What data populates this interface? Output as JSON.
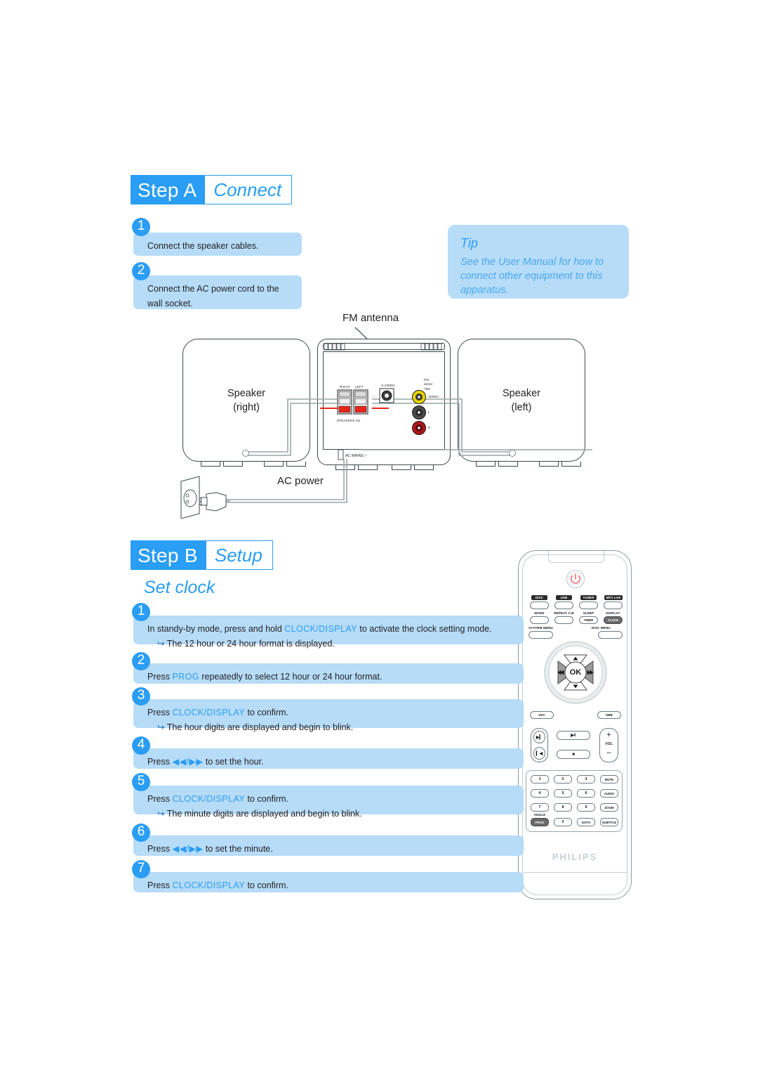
{
  "steps": [
    {
      "id": "step-a",
      "badge": "Step A",
      "title": "Connect",
      "items": [
        {
          "num": "1",
          "text": "Connect the speaker cables."
        },
        {
          "num": "2",
          "text": "Connect the AC power cord to the wall socket."
        }
      ]
    },
    {
      "id": "step-b",
      "badge": "Step B",
      "title": "Setup",
      "subtitle": "Set clock",
      "items": [
        {
          "num": "1",
          "pre": "In standy-by mode, press and hold ",
          "hl": "CLOCK/DISPLAY",
          "post": " to activate the clock setting mode.",
          "sub": "The 12 hour or 24 hour format is displayed."
        },
        {
          "num": "2",
          "pre": "Press ",
          "hl": "PROG",
          "post": " repeatedly to select 12 hour or 24 hour format.",
          "sub": ""
        },
        {
          "num": "3",
          "pre": "Press ",
          "hl": "CLOCK/DISPLAY",
          "post": " to confirm.",
          "sub": "The hour digits are displayed and begin to blink."
        },
        {
          "num": "4",
          "pre": "Press ",
          "hl": "◀◀/▶▶",
          "post": " to set the hour.",
          "sub": ""
        },
        {
          "num": "5",
          "pre": "Press ",
          "hl": "CLOCK/DISPLAY",
          "post": " to confirm.",
          "sub": "The minute digits are displayed and begin to blink."
        },
        {
          "num": "6",
          "pre": "Press ",
          "hl": "◀◀/▶▶",
          "post": " to set the minute.",
          "sub": ""
        },
        {
          "num": "7",
          "pre": "Press ",
          "hl": "CLOCK/DISPLAY",
          "post": " to confirm.",
          "sub": ""
        }
      ]
    }
  ],
  "tip": {
    "title": "Tip",
    "body": "See the User Manual for how to connect other equipment to this apparatus."
  },
  "diagram": {
    "fm_antenna_label": "FM antenna",
    "ac_power_label": "AC power",
    "speaker_right": "Speaker\n(right)",
    "speaker_right_l1": "Speaker",
    "speaker_right_l2": "(right)",
    "speaker_left_l1": "Speaker",
    "speaker_left_l2": "(left)",
    "panel_labels": {
      "right": "RIGHT",
      "left": "LEFT",
      "speakers": "SPEAKERS 4Ω",
      "svideo": "S-VIDEO",
      "fm": "FM",
      "fm_sub": "aerial",
      "fm_ohm": "75Ω",
      "video": "VIDEO",
      "audio_l": "L",
      "audio_r": "R",
      "ac_mains": "AC MAINS ~",
      "minus": "–",
      "plus": "+"
    }
  },
  "remote": {
    "brand": "PHILIPS",
    "power_icon": "power-icon",
    "source_tags": [
      "DISC",
      "USB",
      "TUNER",
      "MP3 Link"
    ],
    "row2_labels": [
      "MODE",
      "REPEAT A-B",
      "SLEEP",
      "DISPLAY"
    ],
    "row3": {
      "timer": "TIMER",
      "clock": "CLOCK"
    },
    "menus": {
      "system": "SYSTEM MENU",
      "disc": "DISC MENU"
    },
    "nav": {
      "ok": "OK",
      "up": "▲",
      "down": "▼",
      "left": "◀◀",
      "right": "▶▶"
    },
    "sound": {
      "dsc": "DSC",
      "dbb": "DBB"
    },
    "transport": {
      "next": "▶▎",
      "prev": "▎◀",
      "playpause": "▶‖",
      "stop": "■",
      "vol_plus": "+",
      "vol_label": "VOL",
      "vol_minus": "–"
    },
    "keypad": [
      [
        "1",
        "2",
        "3",
        "MUTE"
      ],
      [
        "4",
        "5",
        "6",
        "AUDIO"
      ],
      [
        "7",
        "8",
        "9",
        "ZOOM"
      ],
      [
        "PROG",
        "0",
        "GOTO",
        "SUBTITLE"
      ]
    ],
    "angle_label": "ANGLE"
  }
}
